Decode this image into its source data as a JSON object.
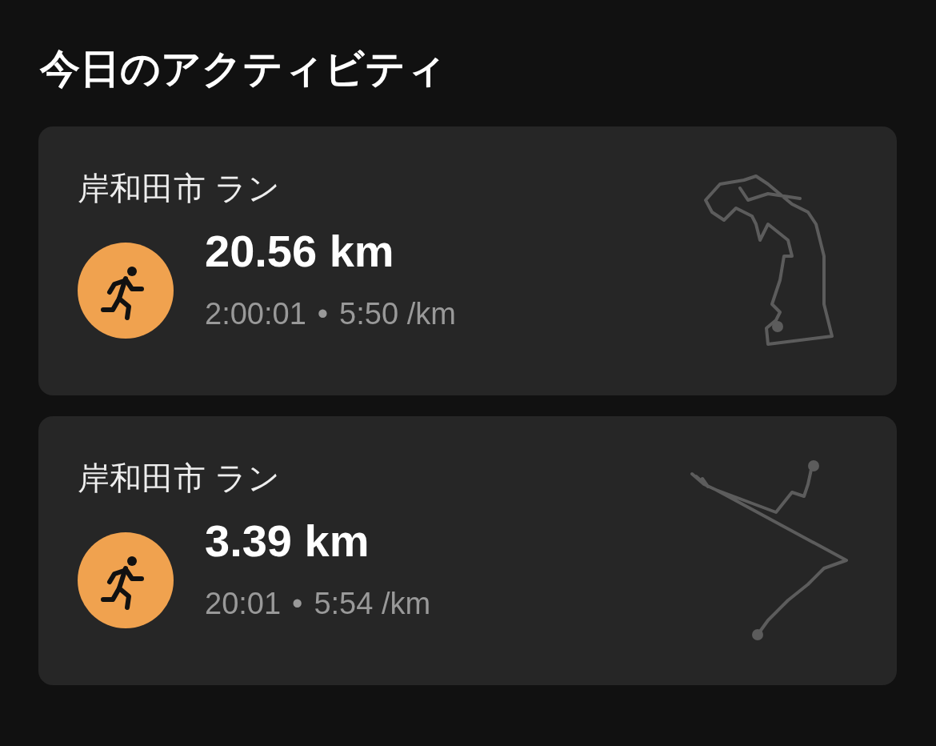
{
  "title": "今日のアクティビティ",
  "activities": [
    {
      "name": "岸和田市 ラン",
      "distance": "20.56 km",
      "time": "2:00:01",
      "separator": "•",
      "pace": "5:50 /km"
    },
    {
      "name": "岸和田市 ラン",
      "distance": "3.39 km",
      "time": "20:01",
      "separator": "•",
      "pace": "5:54 /km"
    }
  ]
}
